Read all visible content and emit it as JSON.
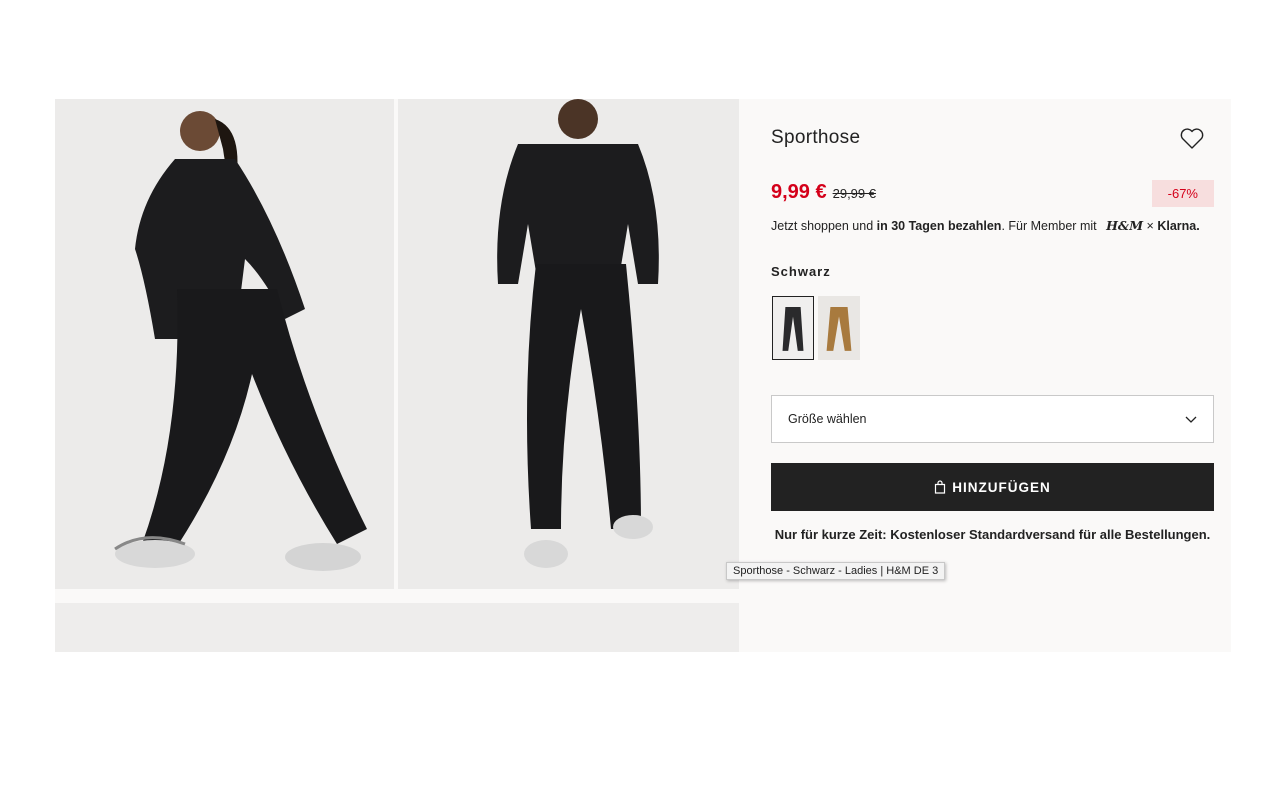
{
  "product": {
    "title": "Sporthose",
    "price": "9,99 €",
    "old_price": "29,99 €",
    "discount_badge": "-67%",
    "klarna_prefix": "Jetzt shoppen und ",
    "klarna_bold": "in 30 Tagen bezahlen",
    "klarna_suffix": ". Für Member mit",
    "hm_logo": "H&M",
    "klarna_times": "×",
    "klarna_logo": "Klarna.",
    "color_name": "Schwarz",
    "colors": [
      {
        "name": "black",
        "hex": "#2a2a2c",
        "selected": true
      },
      {
        "name": "brown",
        "hex": "#a87a3e",
        "selected": false
      }
    ],
    "size_placeholder": "Größe wählen",
    "add_button": "HINZUFÜGEN",
    "shipping_note": "Nur für kurze Zeit: Kostenloser Standardversand für alle Bestellungen."
  },
  "tooltip": "Sporthose - Schwarz - Ladies | H&M DE 3",
  "icons": [
    "heart-icon",
    "chevron-down-icon",
    "shopping-bag-icon"
  ],
  "colors": {
    "sale": "#d4001a",
    "badge_bg": "#f7dede",
    "button_bg": "#222222",
    "panel_bg": "#faf9f8"
  }
}
